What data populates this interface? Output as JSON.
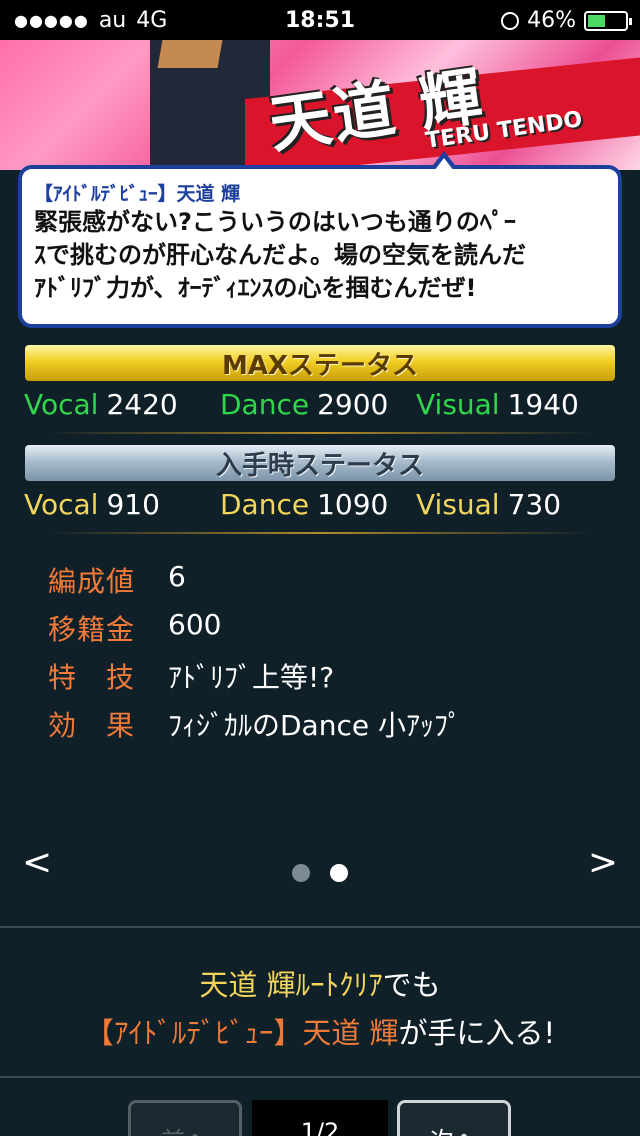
{
  "status_bar": {
    "signal": "●●●●●",
    "carrier": "au",
    "network": "4G",
    "time": "18:51",
    "battery": "46%",
    "battery_level": 0.46
  },
  "banner": {
    "name_jp": "天道 輝",
    "name_en": "TERU TENDO"
  },
  "bubble": {
    "speaker": "【ｱｲﾄﾞﾙﾃﾞﾋﾞｭｰ】天道 輝",
    "lines": [
      "緊張感がない?こういうのはいつも通りのﾍﾟｰ",
      "ｽで挑むのが肝心なんだよ。場の空気を読んだ",
      "ｱﾄﾞﾘﾌﾞ力が、ｵｰﾃﾞｨｴﾝｽの心を掴むんだぜ!"
    ]
  },
  "max_status": {
    "title": "MAXステータス",
    "vocal_label": "Vocal",
    "vocal": "2420",
    "dance_label": "Dance",
    "dance": "2900",
    "visual_label": "Visual",
    "visual": "1940"
  },
  "initial_status": {
    "title": "入手時ステータス",
    "vocal_label": "Vocal",
    "vocal": "910",
    "dance_label": "Dance",
    "dance": "1090",
    "visual_label": "Visual",
    "visual": "730"
  },
  "info": {
    "cost_label": "編成値",
    "cost": "6",
    "transfer_label": "移籍金",
    "transfer": "600",
    "skill_label": "特　技",
    "skill": "ｱﾄﾞﾘﾌﾞ上等!?",
    "effect_label": "効　果",
    "effect": "ﾌｨｼﾞｶﾙのDance 小ｱｯﾌﾟ"
  },
  "pager": {
    "left_arrow": "<",
    "right_arrow": ">"
  },
  "clear_message": {
    "line1_highlight": "天道 輝ﾙｰﾄｸﾘｱ",
    "line1_rest": "でも",
    "line2_highlight": "【ｱｲﾄﾞﾙﾃﾞﾋﾞｭｰ】天道 輝",
    "line2_rest": "が手に入る!"
  },
  "bottom_nav": {
    "prev_label": "前へ",
    "page_label": "1/2",
    "next_label": "次へ"
  }
}
